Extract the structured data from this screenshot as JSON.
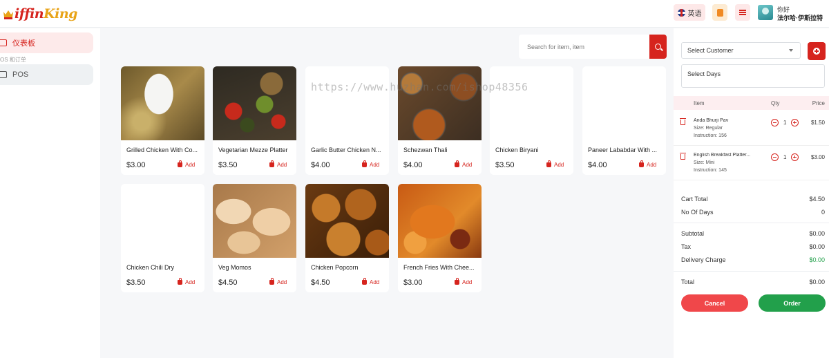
{
  "header": {
    "logo": {
      "first": "iffin",
      "second": "King"
    },
    "language_label": "英语",
    "greeting": "你好",
    "user_name": "法尔哈·伊斯拉特"
  },
  "sidebar": {
    "dashboard_label": "仪表板",
    "section_label": "OS 和订单",
    "pos_label": "POS"
  },
  "search": {
    "placeholder": "Search for item, item"
  },
  "products": [
    {
      "name": "Grilled Chicken With Co...",
      "price": "$3.00",
      "add_label": "Add",
      "image": "grilled-chicken"
    },
    {
      "name": "Vegetarian Mezze Platter",
      "price": "$3.50",
      "add_label": "Add",
      "image": "mezze-platter"
    },
    {
      "name": "Garlic Butter Chicken N...",
      "price": "$4.00",
      "add_label": "Add",
      "image": "none"
    },
    {
      "name": "Schezwan Thali",
      "price": "$4.00",
      "add_label": "Add",
      "image": "thali"
    },
    {
      "name": "Chicken Biryani",
      "price": "$3.50",
      "add_label": "Add",
      "image": "none"
    },
    {
      "name": "Paneer Lababdar With ...",
      "price": "$4.00",
      "add_label": "Add",
      "image": "none"
    },
    {
      "name": "Chicken Chili Dry",
      "price": "$3.50",
      "add_label": "Add",
      "image": "none"
    },
    {
      "name": "Veg Momos",
      "price": "$4.50",
      "add_label": "Add",
      "image": "momos"
    },
    {
      "name": "Chicken Popcorn",
      "price": "$4.50",
      "add_label": "Add",
      "image": "popcorn"
    },
    {
      "name": "French Fries With Chee...",
      "price": "$3.00",
      "add_label": "Add",
      "image": "fries"
    }
  ],
  "cart": {
    "customer_select": "Select Customer",
    "days_placeholder": "Select Days",
    "columns": {
      "item": "Item",
      "qty": "Qty",
      "price": "Price"
    },
    "items": [
      {
        "name": "Anda Bhurji Pav",
        "size": "Size: Regular",
        "instruction": "Instruction: 156",
        "qty": "1",
        "price": "$1.50"
      },
      {
        "name": "English Breakfast Platter...",
        "size": "Size: Mini",
        "instruction": "Instruction: 145",
        "qty": "1",
        "price": "$3.00"
      }
    ],
    "summary": {
      "cart_total_label": "Cart Total",
      "cart_total": "$4.50",
      "days_label": "No Of Days",
      "days": "0",
      "subtotal_label": "Subtotal",
      "subtotal": "$0.00",
      "tax_label": "Tax",
      "tax": "$0.00",
      "delivery_label": "Delivery Charge",
      "delivery": "$0.00",
      "total_label": "Total",
      "total": "$0.00"
    },
    "cancel_label": "Cancel",
    "order_label": "Order"
  },
  "colors": {
    "brand_red": "#d6241e",
    "brand_gold": "#e8a317",
    "order_green": "#22a04b",
    "cancel_red": "#f0474a"
  },
  "watermark": "https://www.huzhan.com/ishop48356"
}
